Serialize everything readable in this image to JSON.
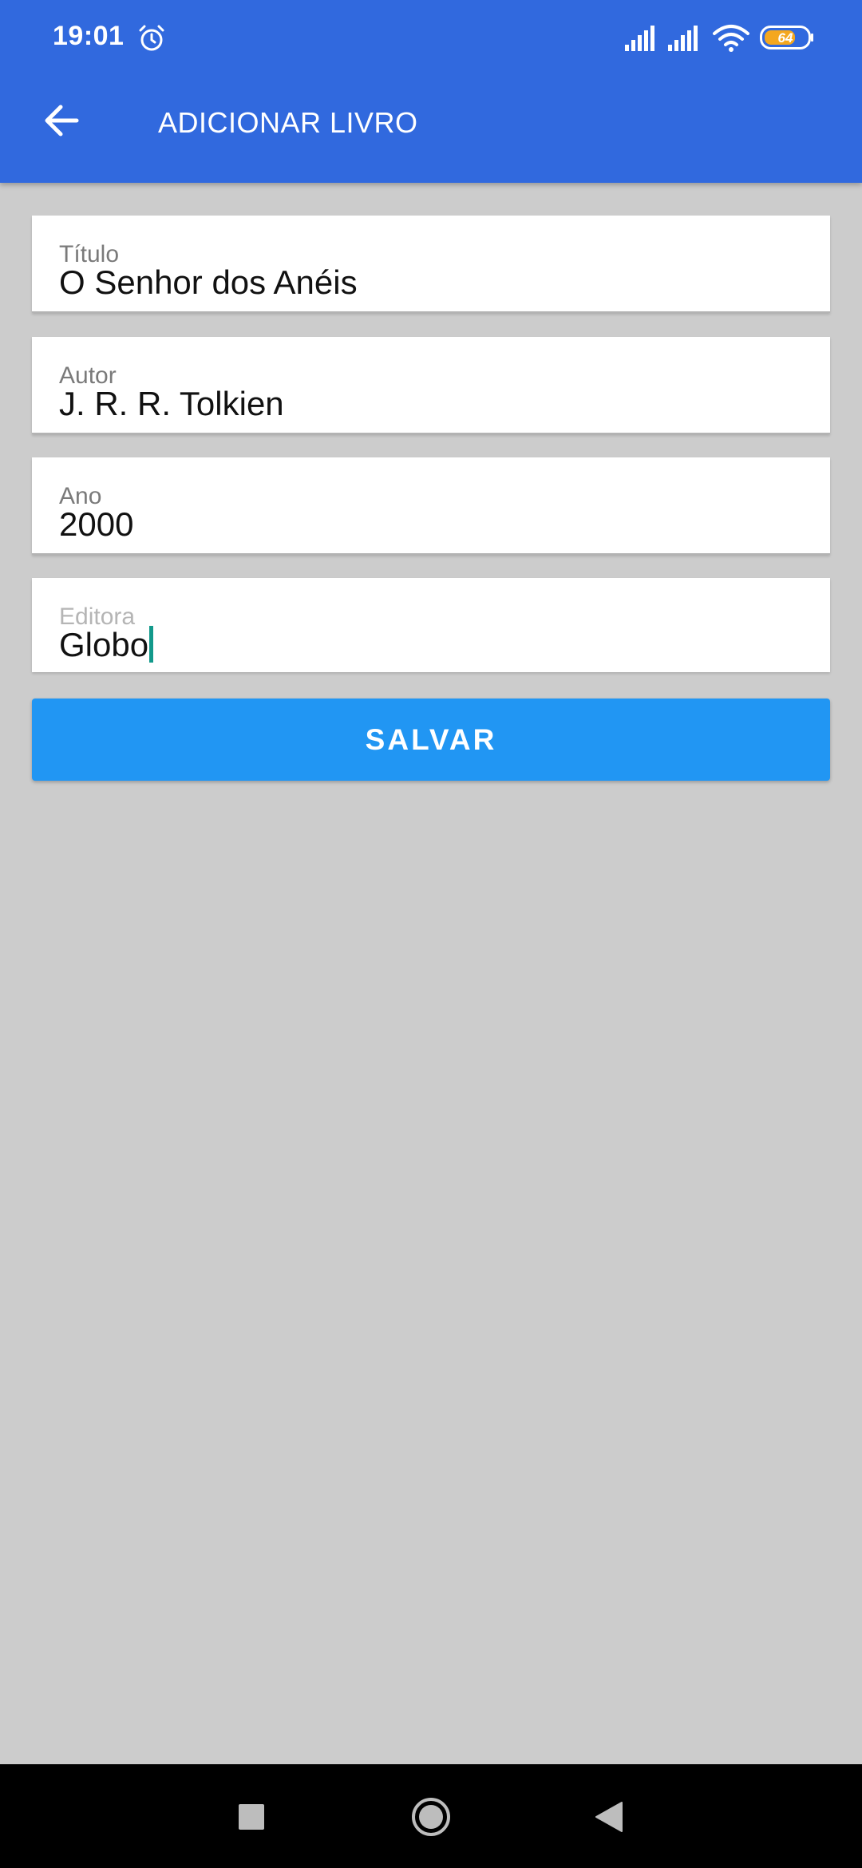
{
  "status_bar": {
    "time": "19:01",
    "battery_level": "64",
    "icons": [
      "alarm-icon",
      "signal-icon",
      "signal-icon",
      "wifi-icon",
      "battery-icon"
    ]
  },
  "app_bar": {
    "title": "ADICIONAR LIVRO",
    "back_icon": "arrow-left-icon"
  },
  "form": {
    "fields": [
      {
        "label": "Título",
        "value": "O Senhor dos Anéis"
      },
      {
        "label": "Autor",
        "value": "J. R. R. Tolkien"
      },
      {
        "label": "Ano",
        "value": "2000"
      },
      {
        "label": "Editora",
        "value": "Globo"
      }
    ],
    "save_label": "SALVAR"
  },
  "colors": {
    "app_bar": "#3169de",
    "button": "#2196f3",
    "background": "#cccccc",
    "cursor": "#12998b"
  },
  "nav_bar": {
    "icons": [
      "recents-icon",
      "home-icon",
      "back-icon"
    ]
  }
}
